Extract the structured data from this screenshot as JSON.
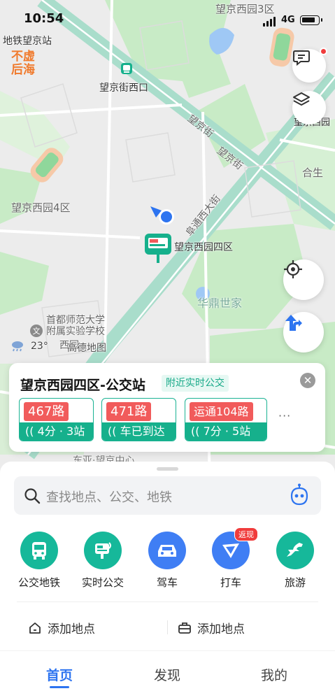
{
  "status_bar": {
    "time": "10:54",
    "network": "4G"
  },
  "map": {
    "labels": {
      "subway_wangjing": "地铁望京站",
      "wangjing_xiyuan3": "望京西园3区",
      "wangjing_jiexikou": "望京街西口",
      "wangjing_jie_1": "望京街",
      "wangjing_jie_2": "望京街",
      "hesheng": "合生",
      "wangjing_xiyuan4": "望京西园4区",
      "futong_xidajie": "阜通西大街",
      "stop_name": "望京西园四区",
      "huading_shijia": "华鼎世家",
      "school_line1": "首都师范大学",
      "school_line2": "附属实验学校",
      "school_line3": "西园",
      "wangjing_center": "东亚·望京中心",
      "right_edge": "望京西园"
    },
    "brand_logo": "不虚后海",
    "watermark": "高德地图",
    "weather_temp": "23°"
  },
  "bus_card": {
    "title": "望京西园四区-公交站",
    "tag": "附近实时公交",
    "more": "···",
    "routes": [
      {
        "line": "467路",
        "eta": "4分 · 3站"
      },
      {
        "line": "471路",
        "eta": "车已到达"
      },
      {
        "line": "运通104路",
        "eta": "7分 · 5站"
      }
    ]
  },
  "search": {
    "placeholder": "查找地点、公交、地铁"
  },
  "quick_actions": [
    {
      "label": "公交地铁",
      "icon": "bus-icon",
      "color": "#16b89a"
    },
    {
      "label": "实时公交",
      "icon": "realtime-bus-icon",
      "color": "#16b89a"
    },
    {
      "label": "驾车",
      "icon": "car-icon",
      "color": "#3f7ef4"
    },
    {
      "label": "打车",
      "icon": "taxi-icon",
      "color": "#3f7ef4",
      "badge": "返现"
    },
    {
      "label": "旅游",
      "icon": "horse-icon",
      "color": "#16b89a"
    }
  ],
  "saved_places": {
    "home": "添加地点",
    "work": "添加地点"
  },
  "tabs": [
    {
      "label": "首页",
      "active": true
    },
    {
      "label": "发现",
      "active": false
    },
    {
      "label": "我的",
      "active": false
    }
  ],
  "colors": {
    "accent": "#2d74f0",
    "teal": "#16b08c",
    "route_red": "#f15b5b",
    "road_green": "#a9ddcb",
    "park_green": "#c8ebc6"
  }
}
